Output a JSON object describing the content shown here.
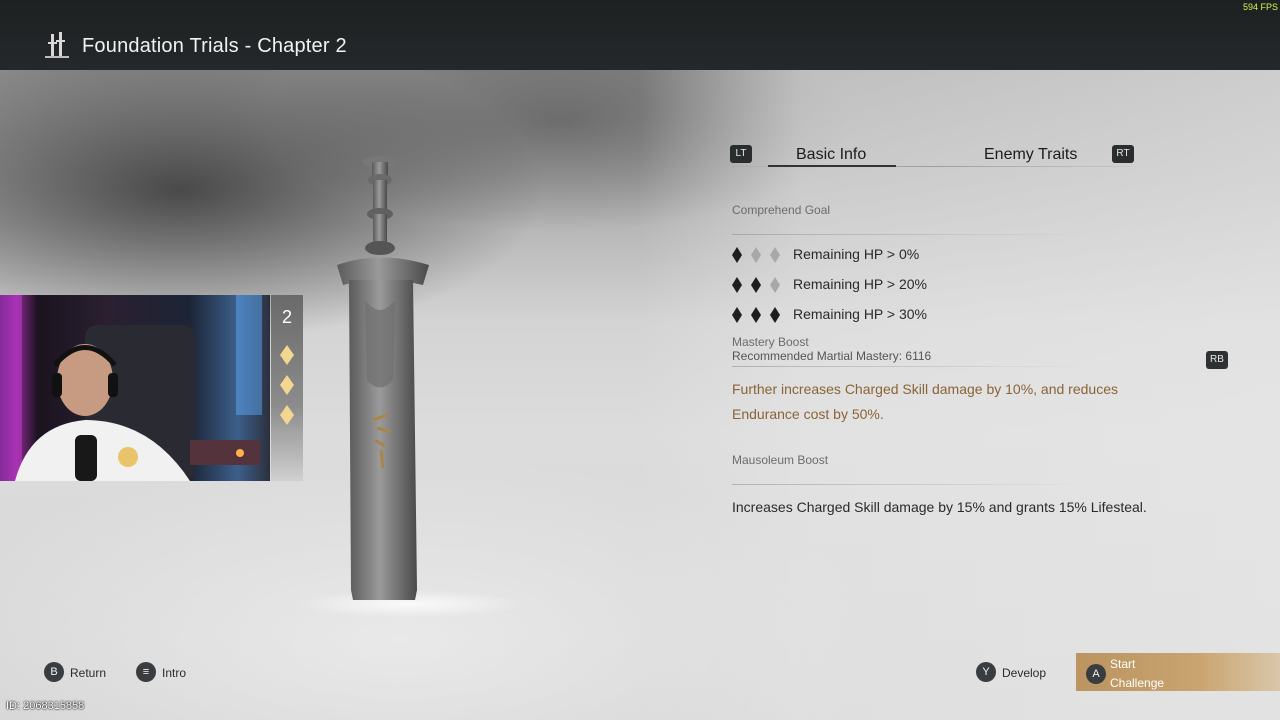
{
  "header": {
    "title": "Foundation Trials - Chapter 2",
    "fps": "594 FPS",
    "logo_icon": "swords-icon"
  },
  "difficulty": {
    "level": "2",
    "rating_icon": "diamond-icon",
    "rating_count": 3
  },
  "tabs": {
    "left_button": "LT",
    "right_button": "RT",
    "items": [
      {
        "label": "Basic Info",
        "active": true
      },
      {
        "label": "Enemy Traits",
        "active": false
      }
    ]
  },
  "comprehend_goal": {
    "label": "Comprehend Goal",
    "goals": [
      {
        "text": "Remaining HP > 0%",
        "filled": 1,
        "total": 3
      },
      {
        "text": "Remaining HP > 20%",
        "filled": 2,
        "total": 3
      },
      {
        "text": "Remaining HP > 30%",
        "filled": 3,
        "total": 3
      }
    ]
  },
  "mastery": {
    "label": "Mastery Boost",
    "recommended": "Recommended Martial Mastery: 6116",
    "description": "Further increases Charged Skill damage by 10%, and reduces Endurance cost by 50%.",
    "button": "RB"
  },
  "mausoleum": {
    "label": "Mausoleum Boost",
    "description": "Increases Charged Skill damage by 15% and grants 15% Lifesteal."
  },
  "controls": {
    "return": {
      "button": "B",
      "label": "Return"
    },
    "intro": {
      "button": "≡",
      "label": "Intro"
    },
    "develop": {
      "button": "Y",
      "label": "Develop"
    },
    "start": {
      "button": "A",
      "label": "Start Challenge"
    }
  },
  "user_id": "ID: 2068315858",
  "colors": {
    "accent_gold": "#8a6437",
    "start_button": "#c9a470",
    "topbar": "#202425"
  }
}
